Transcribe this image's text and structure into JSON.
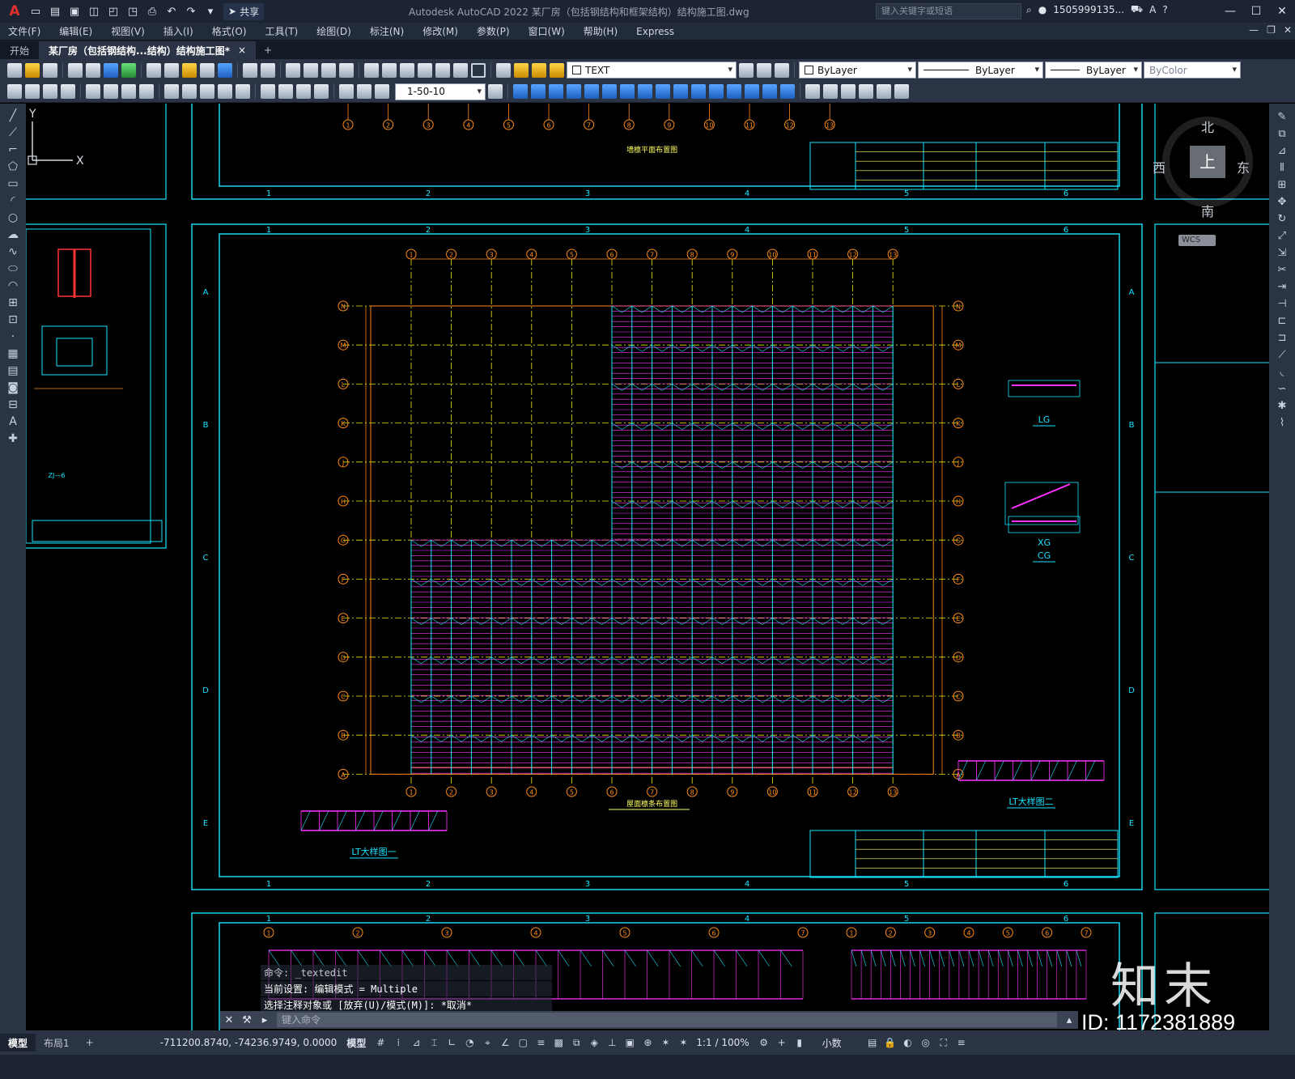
{
  "titlebar": {
    "app_title": "Autodesk AutoCAD 2022    某厂房（包括钢结构和框架结构）结构施工图.dwg",
    "share_label": "共享",
    "search_placeholder": "键入关键字或短语",
    "user": "1505999135...",
    "logo": "A"
  },
  "menubar": {
    "items": [
      "文件(F)",
      "编辑(E)",
      "视图(V)",
      "插入(I)",
      "格式(O)",
      "工具(T)",
      "绘图(D)",
      "标注(N)",
      "修改(M)",
      "参数(P)",
      "窗口(W)",
      "帮助(H)",
      "Express"
    ]
  },
  "tabs": {
    "start": "开始",
    "active": "某厂房（包括钢结构...结构）结构施工图*",
    "close": "×",
    "add": "+"
  },
  "toolbar": {
    "text_style": "TEXT",
    "layer_color": "ByLayer",
    "linetype": "ByLayer",
    "lineweight": "ByLayer",
    "plot_style": "ByColor",
    "scale_list": "1-50-10"
  },
  "viewcube": {
    "north": "北",
    "south": "南",
    "east": "东",
    "west": "西",
    "face": "上",
    "wcs": "WCS"
  },
  "ucs": {
    "x": "X",
    "y": "Y"
  },
  "drawing": {
    "column_grid_top": [
      "1",
      "2",
      "3",
      "4",
      "5",
      "6",
      "7",
      "8",
      "9",
      "10",
      "11",
      "12",
      "13"
    ],
    "row_grid": [
      "N",
      "M",
      "L",
      "K",
      "J",
      "H",
      "G",
      "F",
      "E",
      "D",
      "C",
      "B",
      "A"
    ],
    "frame_cols": [
      "1",
      "2",
      "3",
      "4",
      "5",
      "6"
    ],
    "frame_rows": [
      "A",
      "B",
      "C",
      "D",
      "E"
    ],
    "plan_title": "屋面檩条布置图",
    "top_plan_title": "墙檩平面布置图",
    "detail_lg": "LG",
    "detail_xg": "XG",
    "detail_cg": "CG",
    "detail_lt1": "LT大样图一",
    "detail_lt2": "LT大样图二"
  },
  "command": {
    "history": [
      "命令: _textedit",
      "当前设置: 编辑模式 = Multiple",
      "选择注释对象或 [放弃(U)/模式(M)]: *取消*"
    ],
    "input_placeholder": "键入命令"
  },
  "statusbar": {
    "model_tab": "模型",
    "layout_tab": "布局1",
    "add_layout": "+",
    "coords": "-711200.8740, -74236.9749, 0.0000",
    "mode": "模型",
    "scale": "1:1 / 100%",
    "units": "小数"
  },
  "watermark": {
    "brand": "知末",
    "id": "ID: 1172381889"
  },
  "colors": {
    "grid_orange": "#ff8c1a",
    "frame_cyan": "#19e3ff",
    "purlin_magenta": "#ff33ff",
    "axis_yellow": "#e8e81a"
  }
}
